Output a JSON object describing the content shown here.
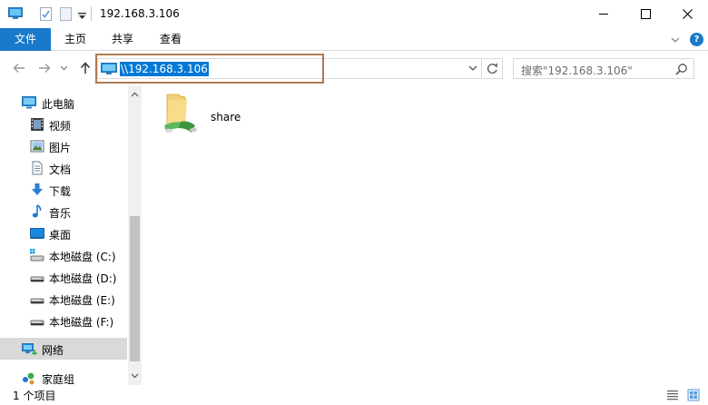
{
  "window": {
    "title": "192.168.3.106",
    "controls": {
      "minimize": "minimize",
      "maximize": "maximize",
      "close": "close"
    }
  },
  "ribbon": {
    "tabs": [
      {
        "label": "文件",
        "active": true
      },
      {
        "label": "主页",
        "active": false
      },
      {
        "label": "共享",
        "active": false
      },
      {
        "label": "查看",
        "active": false
      }
    ],
    "help": "?"
  },
  "address": {
    "value": "\\\\192.168.3.106",
    "search_placeholder": "搜索\"192.168.3.106\""
  },
  "sidebar": {
    "items": [
      {
        "label": "此电脑",
        "icon": "computer-icon"
      },
      {
        "label": "视频",
        "icon": "video-icon"
      },
      {
        "label": "图片",
        "icon": "pictures-icon"
      },
      {
        "label": "文档",
        "icon": "documents-icon"
      },
      {
        "label": "下载",
        "icon": "download-icon"
      },
      {
        "label": "音乐",
        "icon": "music-icon"
      },
      {
        "label": "桌面",
        "icon": "desktop-icon"
      },
      {
        "label": "本地磁盘 (C:)",
        "icon": "system-drive-icon"
      },
      {
        "label": "本地磁盘 (D:)",
        "icon": "drive-icon"
      },
      {
        "label": "本地磁盘 (E:)",
        "icon": "drive-icon"
      },
      {
        "label": "本地磁盘 (F:)",
        "icon": "drive-icon"
      },
      {
        "label": "网络",
        "icon": "network-icon",
        "selected": true
      },
      {
        "label": "家庭组",
        "icon": "homegroup-icon"
      }
    ]
  },
  "content": {
    "items": [
      {
        "label": "share",
        "icon": "shared-folder-icon"
      }
    ]
  },
  "status": {
    "text": "1 个项目"
  },
  "colors": {
    "accent": "#1979ca",
    "selection": "#0078d7",
    "highlight_border": "#b07a4f"
  }
}
